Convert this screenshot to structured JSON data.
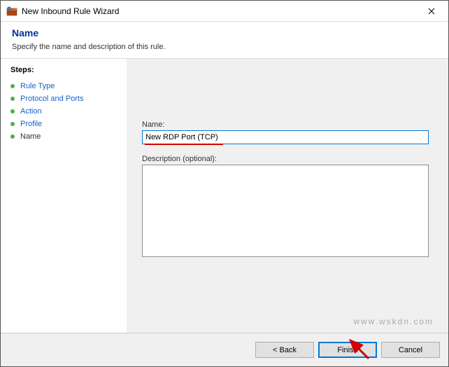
{
  "window": {
    "title": "New Inbound Rule Wizard"
  },
  "header": {
    "title": "Name",
    "subtitle": "Specify the name and description of this rule."
  },
  "sidebar": {
    "steps_label": "Steps:",
    "items": [
      {
        "label": "Rule Type"
      },
      {
        "label": "Protocol and Ports"
      },
      {
        "label": "Action"
      },
      {
        "label": "Profile"
      },
      {
        "label": "Name"
      }
    ]
  },
  "form": {
    "name_label": "Name:",
    "name_value": "New RDP Port (TCP)",
    "desc_label": "Description (optional):",
    "desc_value": ""
  },
  "buttons": {
    "back": "< Back",
    "finish": "Finish",
    "cancel": "Cancel"
  },
  "watermark": "www.wskdn.com"
}
